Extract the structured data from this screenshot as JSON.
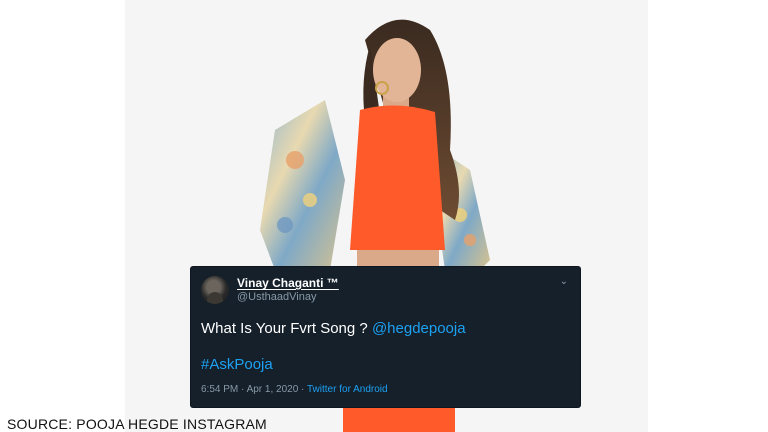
{
  "tweet": {
    "user_name": "Vinay Chaganti ™",
    "user_handle": "@UsthaadVinay",
    "menu_icon": "chevron-down-icon",
    "text_prefix": "What Is Your Fvrt Song ?",
    "mention": "@hegdepooja",
    "hashtag": "#AskPooja",
    "time": "6:54 PM · Apr 1, 2020 · ",
    "source": "Twitter for Android"
  },
  "caption": "SOURCE: POOJA HEGDE INSTAGRAM",
  "colors": {
    "tweet_bg": "#15202b",
    "link": "#1da1f2",
    "muted": "#8899a6",
    "top": "#ff5a2a"
  }
}
